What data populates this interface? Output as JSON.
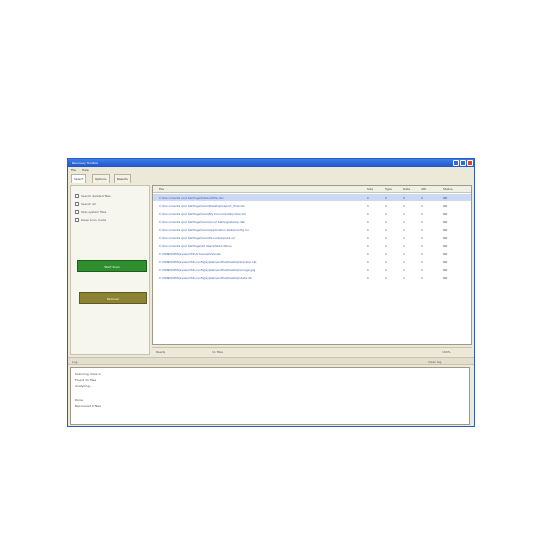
{
  "window": {
    "title": "Recovery Toolbox",
    "menu": [
      "File",
      "Help"
    ]
  },
  "tabs": [
    "Select",
    "Options",
    "Results"
  ],
  "left_panel": {
    "options": [
      "Search deleted files",
      "Search all",
      "Skip system files",
      "Deep scan mode"
    ],
    "green_button": "Start Scan",
    "olive_button": "Recover"
  },
  "list": {
    "columns": [
      "File",
      "Size",
      "Type",
      "Date",
      "Attr",
      "Status"
    ],
    "rows": [
      {
        "path": "C:\\Documents and Settings\\Default\\file.doc",
        "vals": [
          "1",
          "1",
          "1",
          "1",
          "OK"
        ]
      },
      {
        "path": "C:\\Documents and Settings\\User\\Desktop\\report_final.xls",
        "vals": [
          "1",
          "1",
          "1",
          "1",
          "OK"
        ]
      },
      {
        "path": "C:\\Documents and Settings\\User\\My Documents\\notes.txt",
        "vals": [
          "1",
          "1",
          "1",
          "1",
          "OK"
        ]
      },
      {
        "path": "C:\\Documents and Settings\\User\\Local Settings\\temp.dat",
        "vals": [
          "1",
          "1",
          "1",
          "1",
          "OK"
        ]
      },
      {
        "path": "C:\\Documents and Settings\\User\\Application Data\\config.ini",
        "vals": [
          "1",
          "1",
          "1",
          "1",
          "OK"
        ]
      },
      {
        "path": "C:\\Documents and Settings\\User\\Favorites\\links.url",
        "vals": [
          "1",
          "1",
          "1",
          "1",
          "OK"
        ]
      },
      {
        "path": "C:\\Documents and Settings\\All Users\\Start Menu",
        "vals": [
          "1",
          "1",
          "1",
          "1",
          "OK"
        ]
      },
      {
        "path": "C:\\WINDOWS\\system32\\drivers\\etc\\hosts",
        "vals": [
          "1",
          "1",
          "1",
          "1",
          "OK"
        ]
      },
      {
        "path": "C:\\WINDOWS\\system32\\config\\systemprofile\\Desktop\\backup.zip",
        "vals": [
          "1",
          "1",
          "1",
          "1",
          "OK"
        ]
      },
      {
        "path": "C:\\WINDOWS\\system32\\config\\systemprofile\\Desktop\\image.jpg",
        "vals": [
          "1",
          "1",
          "1",
          "1",
          "OK"
        ]
      },
      {
        "path": "C:\\WINDOWS\\system32\\config\\systemprofile\\Desktop\\data.db",
        "vals": [
          "1",
          "1",
          "1",
          "1",
          "OK"
        ]
      }
    ]
  },
  "status": {
    "left": "Ready",
    "mid": "11 files",
    "right": "100%"
  },
  "divider": {
    "label": "Log",
    "right": "Clear log"
  },
  "log_lines": [
    "Scanning drive C:",
    "Found 11 files",
    "Analyzing...",
    "Done.",
    "Recovered 0 files"
  ]
}
